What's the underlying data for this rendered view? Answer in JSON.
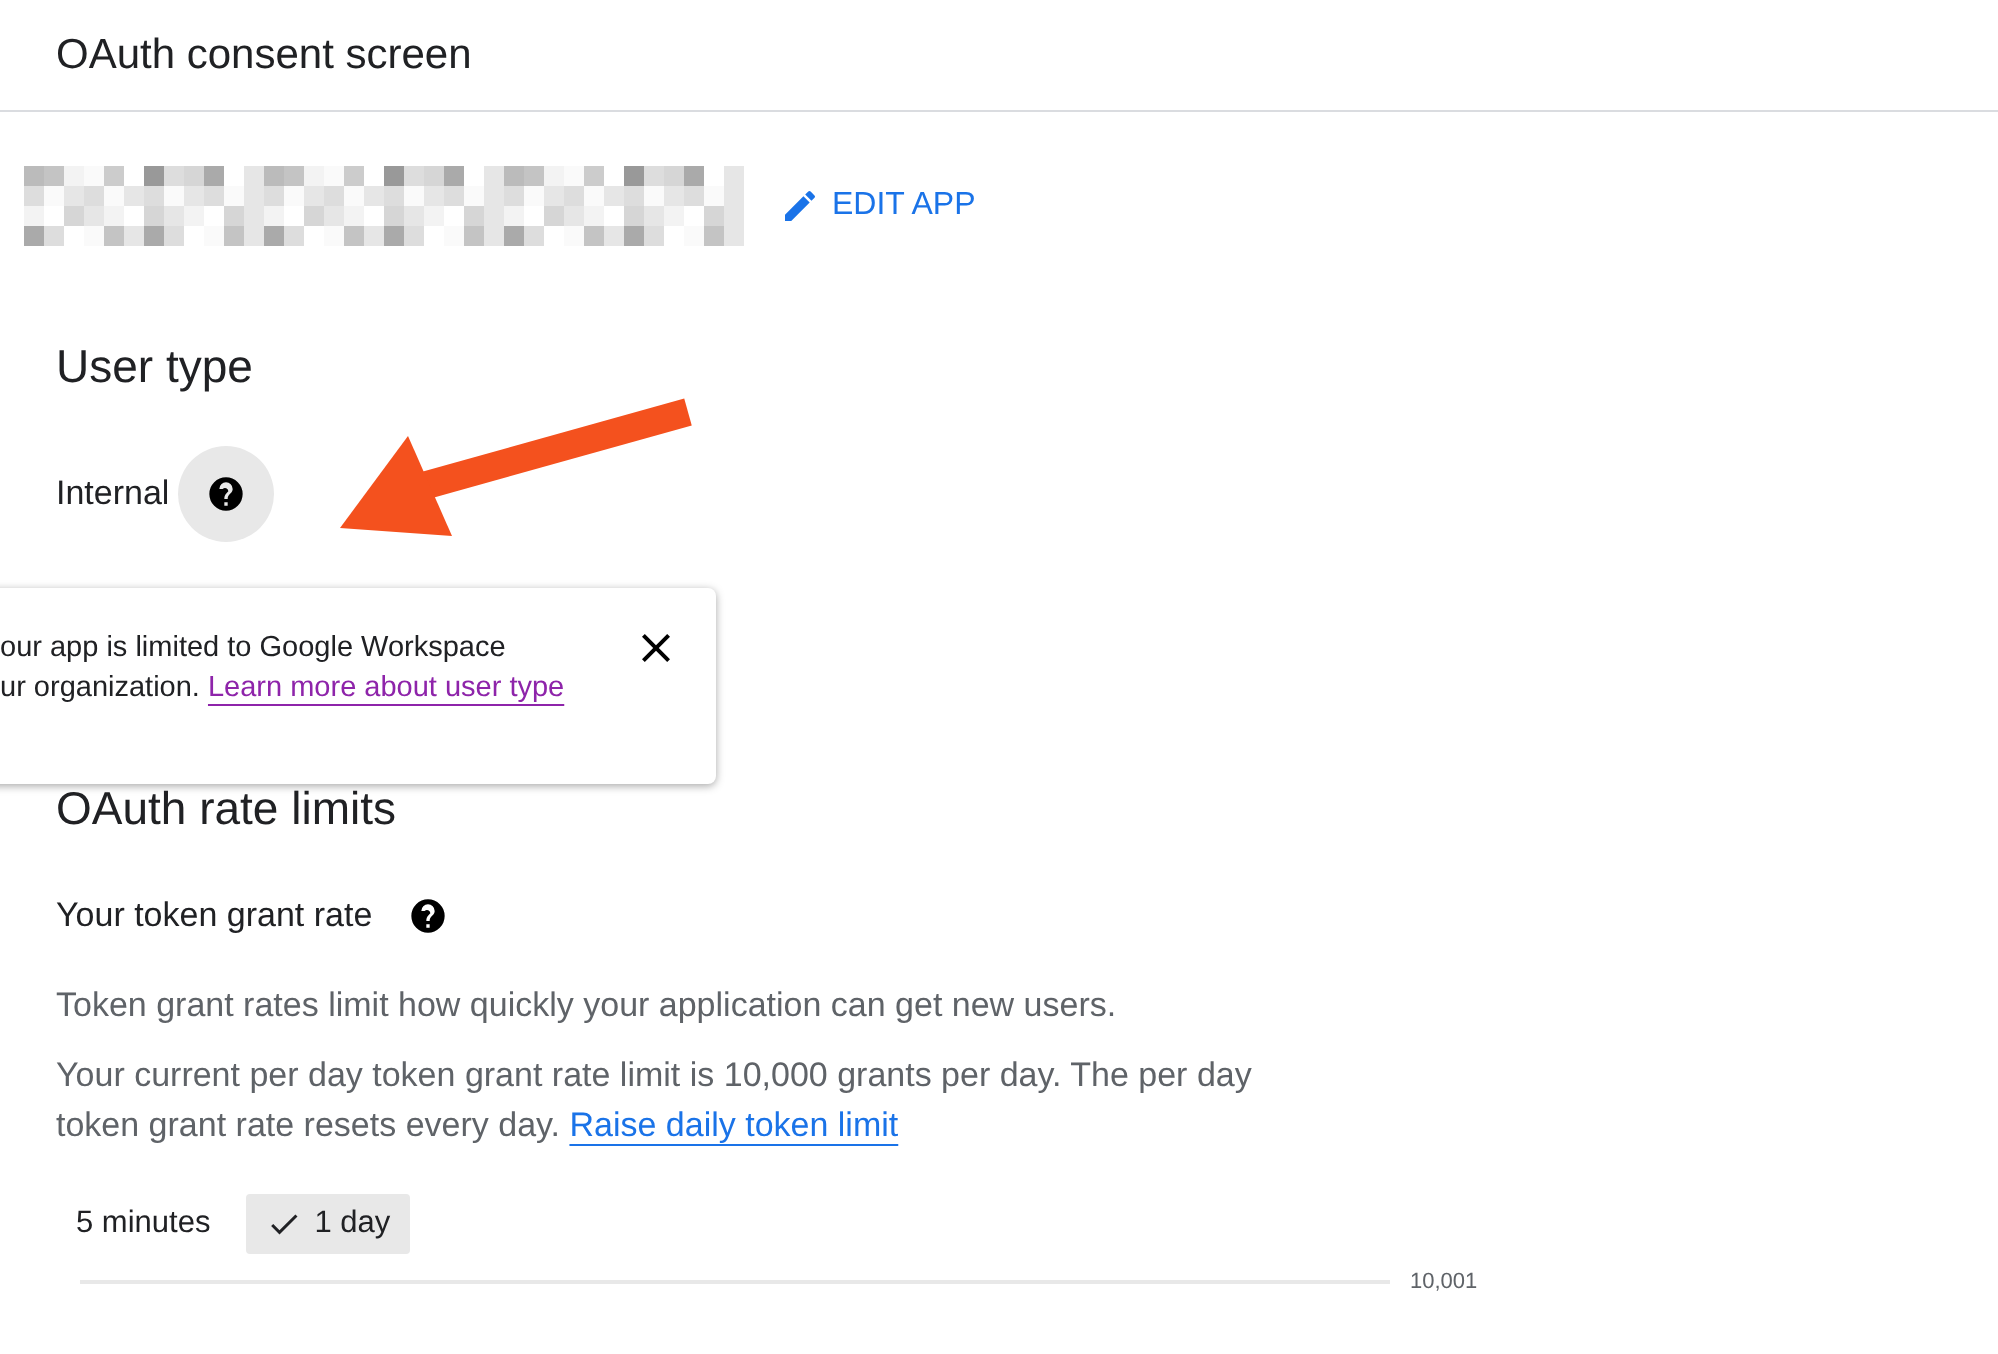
{
  "header": {
    "title": "OAuth consent screen"
  },
  "app": {
    "edit_label": "EDIT APP"
  },
  "user_type": {
    "heading": "User type",
    "value": "Internal",
    "help_active": true
  },
  "tooltip": {
    "lines": [
      "our app is limited to Google Workspace",
      "ur organization."
    ],
    "link": "Learn more about user type"
  },
  "rate_limits": {
    "heading": "OAuth rate limits",
    "subheading": "Your token grant rate",
    "description": "Token grant rates limit how quickly your application can get new users.",
    "limit_text": "Your current per day token grant rate limit is 10,000 grants per day. The per day token grant rate resets every day.",
    "limit_link": "Raise daily token limit"
  },
  "ranges": [
    {
      "label": "5 minutes",
      "selected": false
    },
    {
      "label": "1 day",
      "selected": true
    }
  ],
  "chart": {
    "tick_label": "10,001"
  }
}
